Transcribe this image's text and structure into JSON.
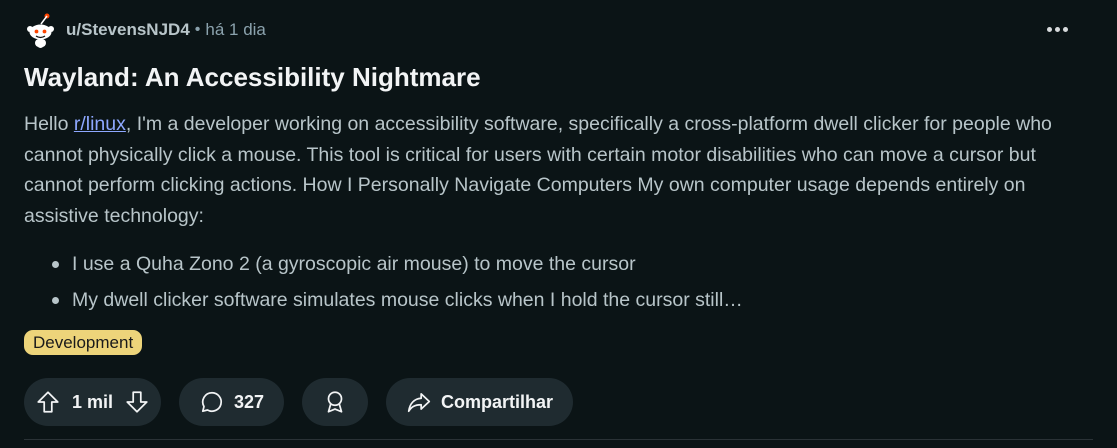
{
  "post": {
    "username": "u/StevensNJD4",
    "separator": "•",
    "timestamp": "há 1 dia",
    "title": "Wayland: An Accessibility Nightmare",
    "body": {
      "intro_before_link": "Hello ",
      "subreddit_link": "r/linux",
      "intro_after_link": ", I'm a developer working on accessibility software, specifically a cross-platform dwell clicker for people who cannot physically click a mouse. This tool is critical for users with certain motor disabilities who can move a cursor but cannot perform clicking actions. How I Personally Navigate Computers My own computer usage depends entirely on assistive technology:"
    },
    "bullets": [
      "I use a Quha Zono 2 (a gyroscopic air mouse) to move the cursor",
      "My dwell clicker software simulates mouse clicks when I hold the cursor still…"
    ],
    "flair": "Development"
  },
  "actions": {
    "vote_count": "1 mil",
    "comment_count": "327",
    "share_label": "Compartilhar"
  },
  "icons": {
    "avatar": "snoo-avatar-icon",
    "more": "more-options-icon",
    "upvote": "upvote-arrow-icon",
    "downvote": "downvote-arrow-icon",
    "comment": "comment-bubble-icon",
    "award": "award-icon",
    "share": "share-arrow-icon"
  },
  "colors": {
    "background": "#0b1416",
    "pill_background": "#1f2b30",
    "link": "#8ea8ff",
    "flair_background": "#edd47a"
  }
}
